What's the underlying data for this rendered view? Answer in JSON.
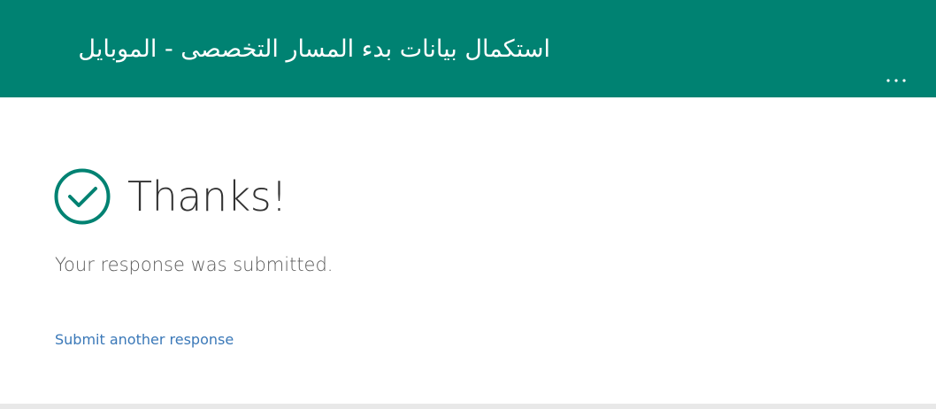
{
  "header": {
    "title": "استكمال بيانات بدء المسار التخصصى - الموبايل",
    "more_icon": "more-horizontal-icon",
    "background_color": "#008272"
  },
  "confirmation": {
    "check_icon": "checkmark-circle-icon",
    "accent_color": "#008272",
    "heading": "Thanks!",
    "message": "Your response was submitted.",
    "submit_another_label": "Submit another response",
    "link_color": "#3a78b8"
  }
}
